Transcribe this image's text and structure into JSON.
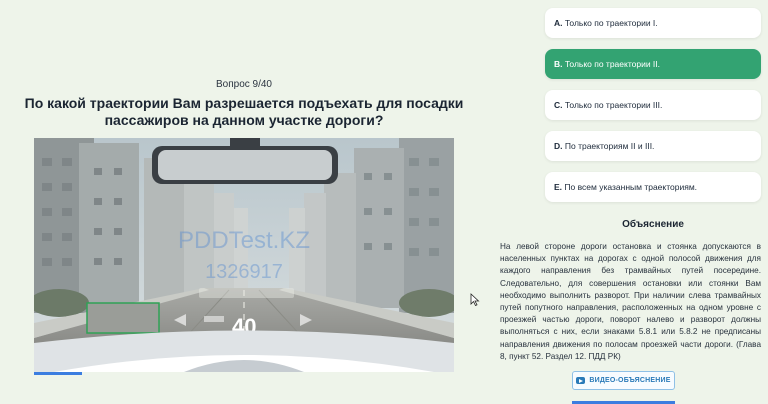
{
  "question": {
    "counter": "Вопрос 9/40",
    "text": "По какой траектории Вам разрешается подъехать для посадки пассажиров на данном участке дороги?"
  },
  "scene": {
    "watermark_line1": "PDDTest.KZ",
    "watermark_line2": "1326917",
    "speed": "40"
  },
  "options": [
    {
      "letter": "A.",
      "text": "Только по траектории I.",
      "selected": false
    },
    {
      "letter": "B.",
      "text": "Только по траектории II.",
      "selected": true
    },
    {
      "letter": "C.",
      "text": "Только по траектории III.",
      "selected": false
    },
    {
      "letter": "D.",
      "text": "По траекториям II и III.",
      "selected": false
    },
    {
      "letter": "E.",
      "text": "По всем указанным траекториям.",
      "selected": false
    }
  ],
  "explanation": {
    "title": "Объяснение",
    "text": "На левой стороне дороги остановка и стоянка допускаются в населенных пунктах на дорогах с одной полосой движения для каждого направления без трамвайных путей посередине. Следовательно, для совершения остановки или стоянки Вам необходимо выполнить разворот. При наличии слева трамвайных путей попутного направления, расположенных на одном уровне с проезжей частью дороги, поворот налево и разворот должны выполняться с них, если знаками 5.8.1 или 5.8.2 не предписаны направления движения по полосам проезжей части дороги. (Глава 8, пункт 52. Раздел 12. ПДД РК)"
  },
  "video_button": {
    "label": "ВИДЕО-ОБЪЯСНЕНИЕ",
    "icon": "youtube-icon"
  },
  "colors": {
    "selected": "#33a372",
    "accent_blue": "#3b7de0",
    "background": "#eef4ea"
  }
}
